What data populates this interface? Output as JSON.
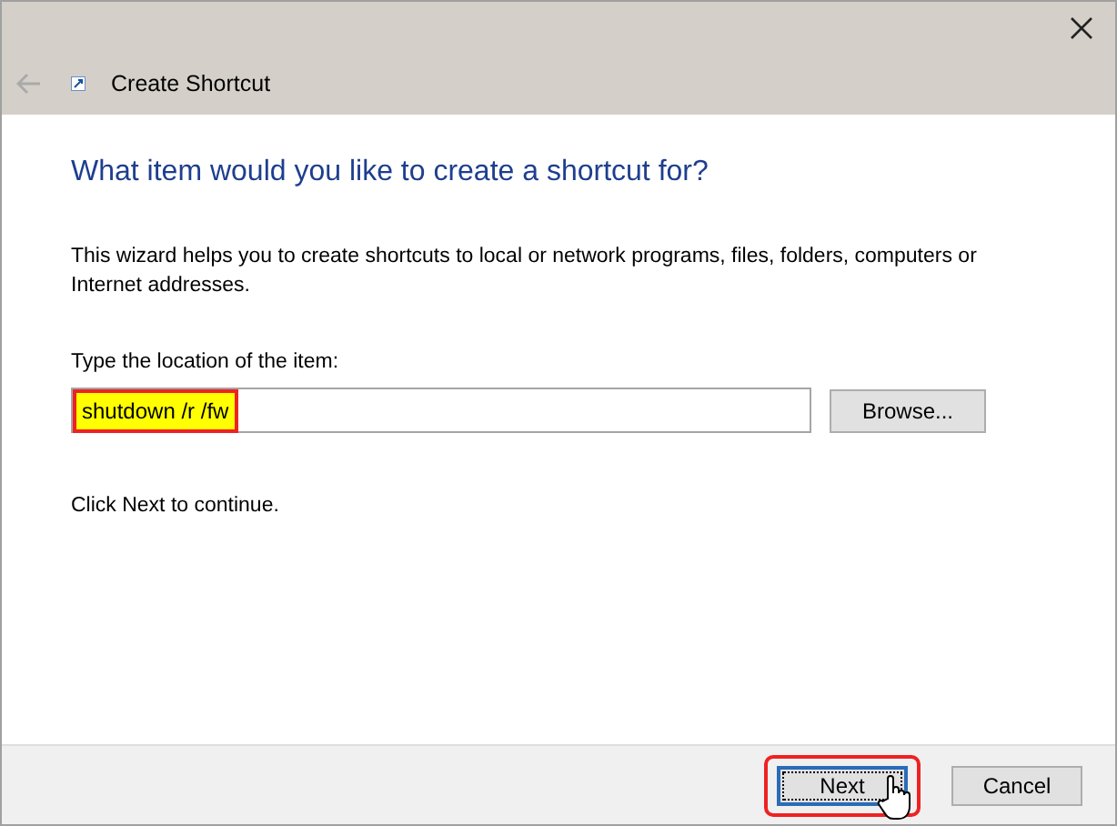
{
  "window": {
    "title": "Create Shortcut"
  },
  "heading": "What item would you like to create a shortcut for?",
  "description": "This wizard helps you to create shortcuts to local or network programs, files, folders, computers or Internet addresses.",
  "location": {
    "label": "Type the location of the item:",
    "value": "shutdown /r /fw",
    "highlighted": true
  },
  "browse_button": "Browse...",
  "hint": "Click Next to continue.",
  "buttons": [
    {
      "label": "Next",
      "highlighted": true,
      "focused": true
    },
    {
      "label": "Cancel",
      "highlighted": false,
      "focused": false
    }
  ]
}
